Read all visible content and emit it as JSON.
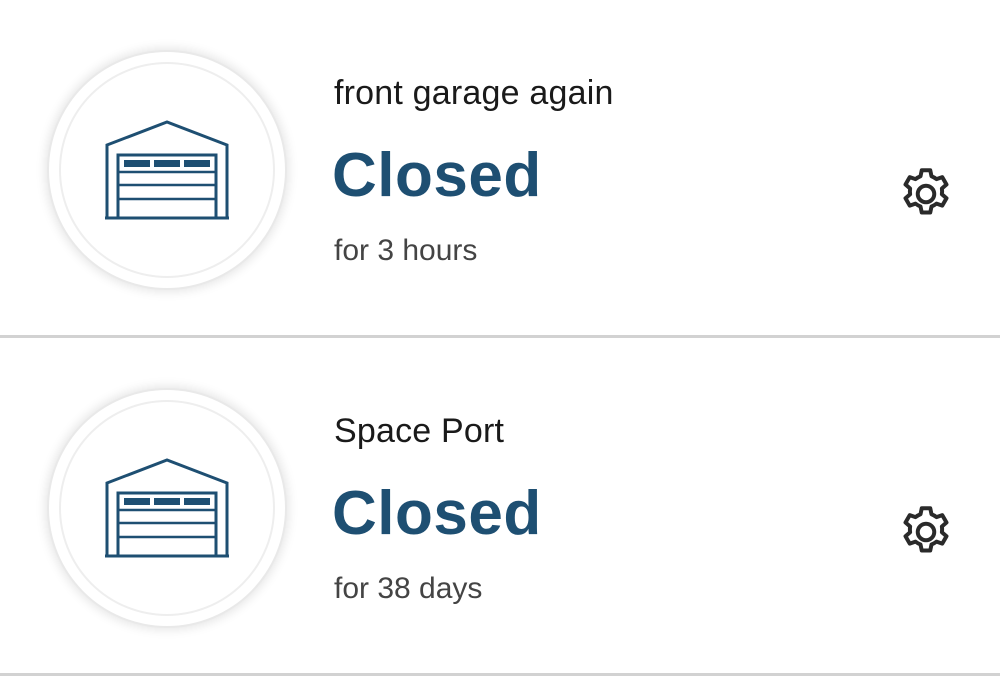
{
  "doors": [
    {
      "name": "front garage again",
      "status": "Closed",
      "duration": "for 3 hours"
    },
    {
      "name": "Space Port",
      "status": "Closed",
      "duration": "for 38 days"
    }
  ],
  "colors": {
    "status": "#1e4f72",
    "icon": "#1e4f72",
    "divider": "#d2d2d2"
  },
  "icons": {
    "door": "garage-door-icon",
    "settings": "gear-icon"
  }
}
